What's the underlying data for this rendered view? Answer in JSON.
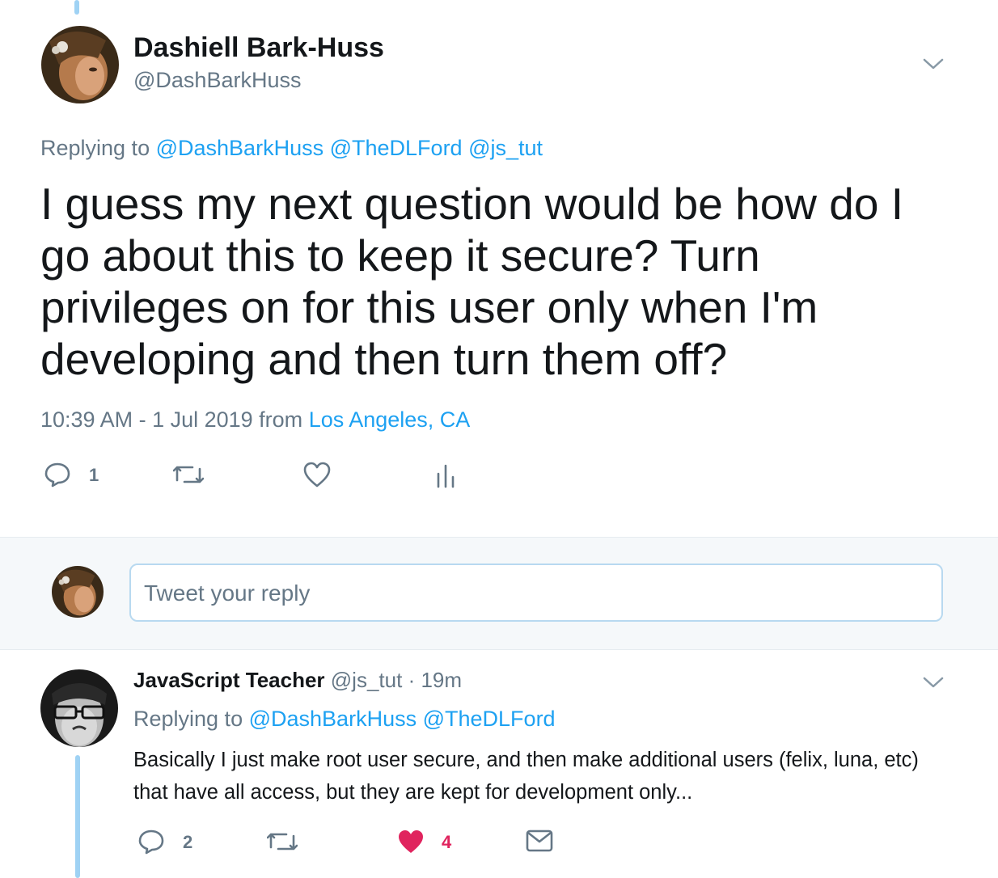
{
  "main_tweet": {
    "author_name": "Dashiell Bark-Huss",
    "handle": "@DashBarkHuss",
    "replying_prefix": "Replying to",
    "replying_to": [
      "@DashBarkHuss",
      "@TheDLFord",
      "@js_tut"
    ],
    "text": "I guess my next question would be how do I go about this to keep it secure? Turn privileges on for this user only when I'm developing and then turn them off?",
    "timestamp": "10:39 AM - 1 Jul 2019 from",
    "location": "Los Angeles, CA",
    "reply_count": "1"
  },
  "reply_box": {
    "placeholder": "Tweet your reply"
  },
  "reply_tweet": {
    "author_name": "JavaScript Teacher",
    "handle": "@js_tut",
    "time": "· 19m",
    "replying_prefix": "Replying to",
    "replying_to": [
      "@DashBarkHuss",
      "@TheDLFord"
    ],
    "text": "Basically I just make root user secure, and then make additional users (felix, luna, etc) that have all access, but they are kept for development only...",
    "reply_count": "2",
    "like_count": "4"
  },
  "colors": {
    "link": "#1da1f2",
    "like": "#e0245e",
    "muted": "#657786"
  }
}
